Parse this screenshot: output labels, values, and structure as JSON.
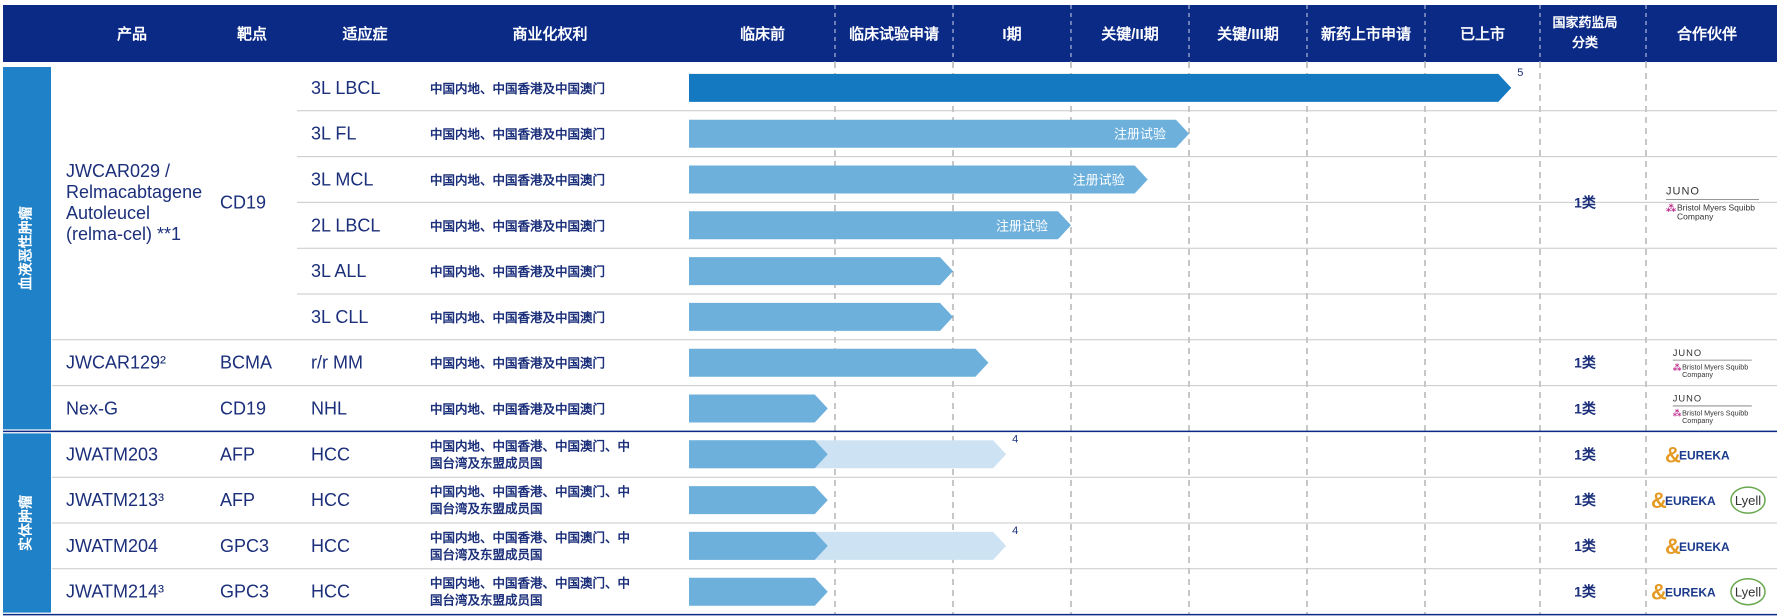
{
  "headers": {
    "product": "产品",
    "target": "靶点",
    "indication": "适应症",
    "rights": "商业化权利",
    "class_line1": "国家药监局",
    "class_line2": "分类",
    "partner": "合作伙伴"
  },
  "stages": [
    "临床前",
    "临床试验申请",
    "I期",
    "关键/II期",
    "关键/III期",
    "新药上市申请",
    "已上市"
  ],
  "groups": [
    {
      "name": "血液恶性肿瘤",
      "row_start": 0,
      "row_end": 7
    },
    {
      "name": "实体肿瘤",
      "row_start": 8,
      "row_end": 11
    }
  ],
  "products": [
    {
      "name_lines": [
        "JWCAR029 /",
        "Relmacabtagene",
        "Autoleucel",
        "(relma-cel) **1"
      ],
      "target": "CD19",
      "row_start": 0,
      "row_end": 5,
      "class": "1类",
      "partners": [
        "JUNO",
        "Bristol Myers Squibb Company"
      ]
    },
    {
      "name_lines": [
        "JWCAR129²"
      ],
      "target": "BCMA",
      "row_start": 6,
      "row_end": 6,
      "class": "1类",
      "partners": [
        "JUNO",
        "Bristol Myers Squibb Company"
      ]
    },
    {
      "name_lines": [
        "Nex-G"
      ],
      "target": "CD19",
      "row_start": 7,
      "row_end": 7,
      "class": "1类",
      "partners": [
        "JUNO",
        "Bristol Myers Squibb Company"
      ]
    },
    {
      "name_lines": [
        "JWATM203"
      ],
      "target": "AFP",
      "row_start": 8,
      "row_end": 8,
      "class": "1类",
      "partners": [
        "EUREKA"
      ]
    },
    {
      "name_lines": [
        "JWATM213³"
      ],
      "target": "AFP",
      "row_start": 9,
      "row_end": 9,
      "class": "1类",
      "partners": [
        "EUREKA",
        "Lyell"
      ]
    },
    {
      "name_lines": [
        "JWATM204"
      ],
      "target": "GPC3",
      "row_start": 10,
      "row_end": 10,
      "class": "1类",
      "partners": [
        "EUREKA"
      ]
    },
    {
      "name_lines": [
        "JWATM214³"
      ],
      "target": "GPC3",
      "row_start": 11,
      "row_end": 11,
      "class": "1类",
      "partners": [
        "EUREKA",
        "Lyell"
      ]
    }
  ],
  "chart_data": {
    "type": "bar",
    "x_axis": "stage",
    "stage_scale_note": "progress values in stage units: 0 = start of 临床前, 7 = end of 已上市",
    "rows": [
      {
        "indication": "3L LBCL",
        "rights": [
          "中国内地、中国香港及中国澳门"
        ],
        "progress": 6.75,
        "style": "approved",
        "bar_label": "",
        "note": "5"
      },
      {
        "indication": "3L FL",
        "rights": [
          "中国内地、中国香港及中国澳门"
        ],
        "progress": 4.0,
        "style": "pivotal",
        "bar_label": "注册试验",
        "note": ""
      },
      {
        "indication": "3L MCL",
        "rights": [
          "中国内地、中国香港及中国澳门"
        ],
        "progress": 3.65,
        "style": "pivotal",
        "bar_label": "注册试验",
        "note": ""
      },
      {
        "indication": "2L LBCL",
        "rights": [
          "中国内地、中国香港及中国澳门"
        ],
        "progress": 3.0,
        "style": "pivotal",
        "bar_label": "注册试验",
        "note": ""
      },
      {
        "indication": "3L ALL",
        "rights": [
          "中国内地、中国香港及中国澳门"
        ],
        "progress": 2.0,
        "style": "clinical",
        "bar_label": "",
        "note": ""
      },
      {
        "indication": "3L CLL",
        "rights": [
          "中国内地、中国香港及中国澳门"
        ],
        "progress": 2.0,
        "style": "clinical",
        "bar_label": "",
        "note": ""
      },
      {
        "indication": "r/r MM",
        "rights": [
          "中国内地、中国香港及中国澳门"
        ],
        "progress": 2.3,
        "style": "clinical",
        "bar_label": "",
        "note": ""
      },
      {
        "indication": "NHL",
        "rights": [
          "中国内地、中国香港及中国澳门"
        ],
        "progress": 0.95,
        "style": "clinical",
        "bar_label": "",
        "note": ""
      },
      {
        "indication": "HCC",
        "rights": [
          "中国内地、中国香港、中国澳门、中",
          "国台湾及东盟成员国"
        ],
        "progress": 0.95,
        "ext_progress": 2.45,
        "style": "clinical",
        "bar_label": "",
        "note": "4"
      },
      {
        "indication": "HCC",
        "rights": [
          "中国内地、中国香港、中国澳门、中",
          "国台湾及东盟成员国"
        ],
        "progress": 0.95,
        "style": "clinical",
        "bar_label": "",
        "note": ""
      },
      {
        "indication": "HCC",
        "rights": [
          "中国内地、中国香港、中国澳门、中",
          "国台湾及东盟成员国"
        ],
        "progress": 0.95,
        "ext_progress": 2.45,
        "style": "clinical",
        "bar_label": "",
        "note": "4"
      },
      {
        "indication": "HCC",
        "rights": [
          "中国内地、中国香港、中国澳门、中",
          "国台湾及东盟成员国"
        ],
        "progress": 0.95,
        "style": "clinical",
        "bar_label": "",
        "note": ""
      }
    ]
  },
  "colors": {
    "header_bg": "#0a2a86",
    "group_bg": "#1f81c7",
    "approved": "#1479c1",
    "clinical": "#6db0dc",
    "extension": "#cde3f3",
    "text": "#1b2f7a",
    "juno": "#333333",
    "bms": "#be2b8c",
    "eureka": "#1b3a8c",
    "eureka_accent": "#e59a24"
  }
}
